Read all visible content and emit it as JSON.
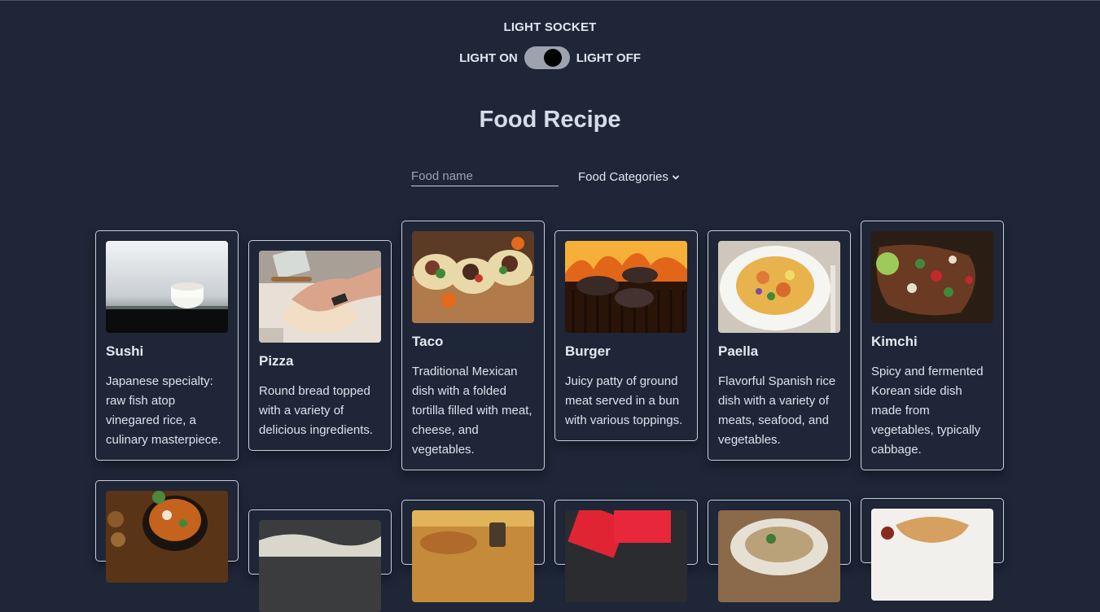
{
  "header": {
    "socket_title": "LIGHT SOCKET",
    "light_on_label": "LIGHT ON",
    "light_off_label": "LIGHT OFF"
  },
  "main": {
    "title": "Food Recipe",
    "search_placeholder": "Food name",
    "categories_label": "Food Categories"
  },
  "recipes": [
    {
      "name": "Sushi",
      "description": "Japanese specialty: raw fish atop vinegared rice, a culinary masterpiece."
    },
    {
      "name": "Pizza",
      "description": "Round bread topped with a variety of delicious ingredients."
    },
    {
      "name": "Taco",
      "description": "Traditional Mexican dish with a folded tortilla filled with meat, cheese, and vegetables."
    },
    {
      "name": "Burger",
      "description": "Juicy patty of ground meat served in a bun with various toppings."
    },
    {
      "name": "Paella",
      "description": "Flavorful Spanish rice dish with a variety of meats, seafood, and vegetables."
    },
    {
      "name": "Kimchi",
      "description": "Spicy and fermented Korean side dish made from vegetables, typically cabbage."
    }
  ],
  "colors": {
    "background": "#1e2638",
    "card_border": "#c8ced8",
    "toggle_track": "#9ca3af"
  }
}
